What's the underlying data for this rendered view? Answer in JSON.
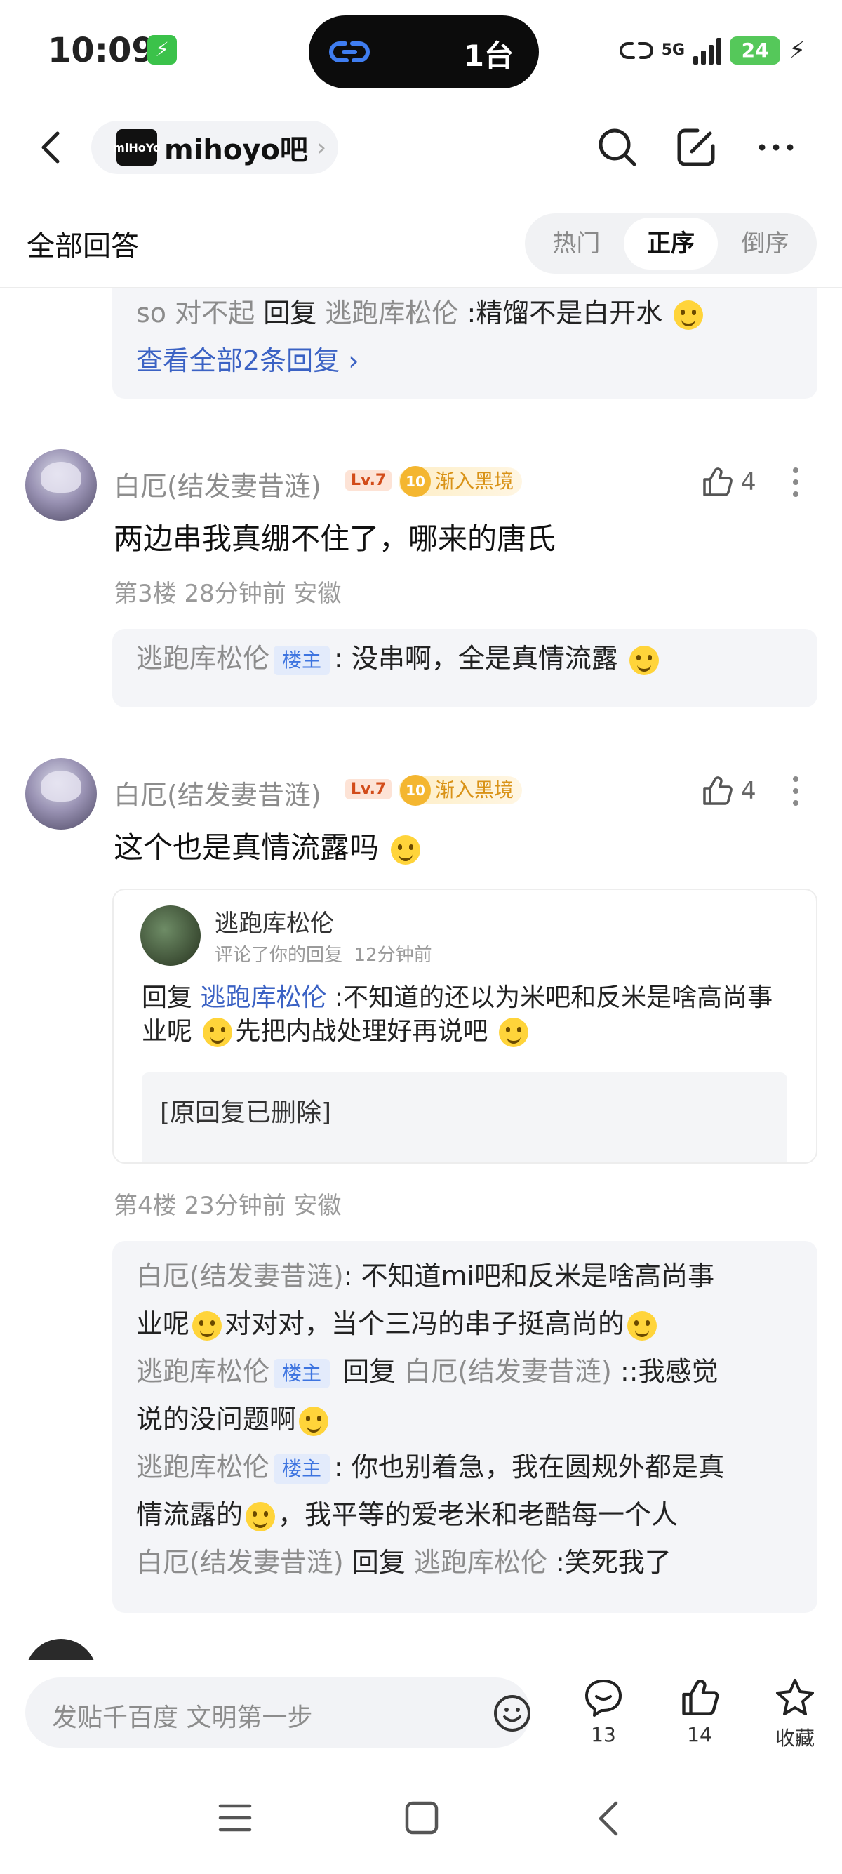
{
  "status_bar": {
    "time": "10:09",
    "island_text": "1台",
    "network": "5G",
    "battery": "24"
  },
  "nav": {
    "forum_logo_text": "miHoYo",
    "forum_name": "mihoyo吧"
  },
  "sort": {
    "title": "全部回答",
    "options": [
      "热门",
      "正序",
      "倒序"
    ],
    "active": "正序"
  },
  "prev_replies": {
    "line1_user": "so 对不起",
    "line1_reply_word": "回复",
    "line1_target": "逃跑库松伦",
    "line1_text": ":精馏不是白开水",
    "view_all": "查看全部2条回复 ›"
  },
  "comments": [
    {
      "username": "白厄(结发妻昔涟)",
      "level": "Lv.7",
      "badge_num": "10",
      "badge_text": "渐入黑境",
      "likes": "4",
      "text": "两边串我真绷不住了，哪来的唐氏",
      "meta": "第3楼 28分钟前 安徽",
      "replies": [
        {
          "user": "逃跑库松伦",
          "op_tag": "楼主",
          "text": ": 没串啊，全是真情流露"
        }
      ]
    },
    {
      "username": "白厄(结发妻昔涟)",
      "level": "Lv.7",
      "badge_num": "10",
      "badge_text": "渐入黑境",
      "likes": "4",
      "text": "这个也是真情流露吗",
      "quote": {
        "user": "逃跑库松伦",
        "subtitle": "评论了你的回复",
        "time": "12分钟前",
        "reply_word": "回复",
        "target": "逃跑库松伦",
        "text1": ":不知道的还以为米吧和反米是啥高",
        "text2": "尚事业呢",
        "text3": "先把内战处理好再说吧",
        "deleted": "[原回复已删除]"
      },
      "meta": "第4楼 23分钟前 安徽",
      "replies": [
        {
          "user": "白厄(结发妻昔涟)",
          "text_a": ": 不知道mi吧和反米是啥高尚事",
          "text_b": "业呢",
          "text_c": "对对对，当个三冯的串子挺高尚的"
        },
        {
          "user": "逃跑库松伦",
          "op_tag": "楼主",
          "reply_word": "回复",
          "target": "白厄(结发妻昔涟)",
          "text_a": "::我感觉",
          "text_b": "说的没问题啊"
        },
        {
          "user": "逃跑库松伦",
          "op_tag": "楼主",
          "text_a": ": 你也别着急，我在圆规外都是真",
          "text_b": "情流露的",
          "text_c": "，我平等的爱老米和老酷每一个人"
        },
        {
          "user": "白厄(结发妻昔涟)",
          "reply_word": "回复",
          "target": "逃跑库松伦",
          "text_a": ":笑死我了"
        }
      ]
    }
  ],
  "bottom_bar": {
    "placeholder": "发贴千百度 文明第一步",
    "comments_count": "13",
    "likes_count": "14",
    "favorite_label": "收藏"
  }
}
